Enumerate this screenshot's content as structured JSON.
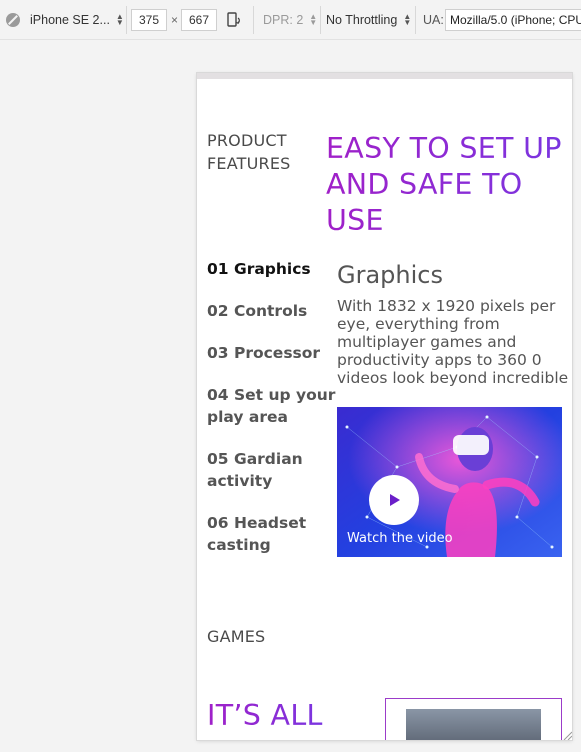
{
  "toolbar": {
    "device": "iPhone SE 2...",
    "width": "375",
    "times": "×",
    "height": "667",
    "dpr": "DPR: 2",
    "throttle": "No Throttling",
    "ua_label": "UA:",
    "ua_value": "Mozilla/5.0 (iPhone; CPU"
  },
  "page": {
    "kicker": [
      "PRODUCT",
      "FEATURES"
    ],
    "headline": [
      "EASY TO SET UP",
      "AND SAFE TO",
      "USE"
    ],
    "features": [
      {
        "label": "01 Graphics",
        "lines": [
          "01 Graphics"
        ]
      },
      {
        "label": "02 Controls",
        "lines": [
          "02 Controls"
        ]
      },
      {
        "label": "03 Processor",
        "lines": [
          "03 Processor"
        ]
      },
      {
        "label": "04 Set up your play area",
        "lines": [
          "04 Set up your",
          "play area"
        ]
      },
      {
        "label": "05 Gardian activity",
        "lines": [
          "05 Gardian",
          "activity"
        ]
      },
      {
        "label": "06 Headset casting",
        "lines": [
          "06 Headset",
          "casting"
        ]
      }
    ],
    "active_feature": "01 Graphics",
    "feature_title": "Graphics",
    "feature_desc": [
      "With 1832 x 1920 pixels per",
      "eye, everything from",
      "multiplayer games and",
      "productivity apps to 360 0",
      "videos look beyond incredible"
    ],
    "video_caption": "Watch the video",
    "games_kicker": "GAMES",
    "games_headline": "IT’S ALL"
  },
  "colors": {
    "accent": "#8a2be2",
    "text": "#555555",
    "active": "#111111"
  },
  "icons": [
    "no-touch-icon",
    "rotate-icon",
    "play-icon",
    "resize-handle-icon"
  ]
}
